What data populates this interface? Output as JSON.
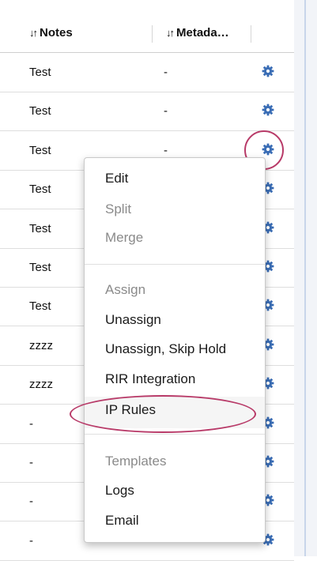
{
  "table": {
    "headers": {
      "notes": "Notes",
      "metadata": "Metada…",
      "sort_glyph": "↓↑"
    },
    "rows": [
      {
        "notes": "Test",
        "metadata": "-"
      },
      {
        "notes": "Test",
        "metadata": "-"
      },
      {
        "notes": "Test",
        "metadata": "-"
      },
      {
        "notes": "Test",
        "metadata": "-"
      },
      {
        "notes": "Test",
        "metadata": "-"
      },
      {
        "notes": "Test",
        "metadata": "-"
      },
      {
        "notes": "Test",
        "metadata": "-"
      },
      {
        "notes": "zzzz",
        "metadata": "-"
      },
      {
        "notes": "zzzz",
        "metadata": "-"
      },
      {
        "notes": "-",
        "metadata": "-"
      },
      {
        "notes": "-",
        "metadata": "-"
      },
      {
        "notes": "-",
        "metadata": "-"
      },
      {
        "notes": "-",
        "metadata": "-"
      }
    ]
  },
  "menu": {
    "items": [
      {
        "label": "Edit",
        "disabled": false
      },
      {
        "label": "Split",
        "disabled": true
      },
      {
        "label": "Merge",
        "disabled": true
      },
      {
        "label": "Assign",
        "disabled": true
      },
      {
        "label": "Unassign",
        "disabled": false
      },
      {
        "label": "Unassign, Skip Hold",
        "disabled": false
      },
      {
        "label": "RIR Integration",
        "disabled": false
      },
      {
        "label": "IP Rules",
        "disabled": false,
        "highlighted": true
      },
      {
        "label": "Templates",
        "disabled": true
      },
      {
        "label": "Logs",
        "disabled": false
      },
      {
        "label": "Email",
        "disabled": false
      }
    ]
  },
  "icons": {
    "row_action": "gear-icon"
  },
  "colors": {
    "gear": "#3a6db5",
    "annotation": "#b83a68",
    "disabled_text": "#8a8a8a"
  }
}
